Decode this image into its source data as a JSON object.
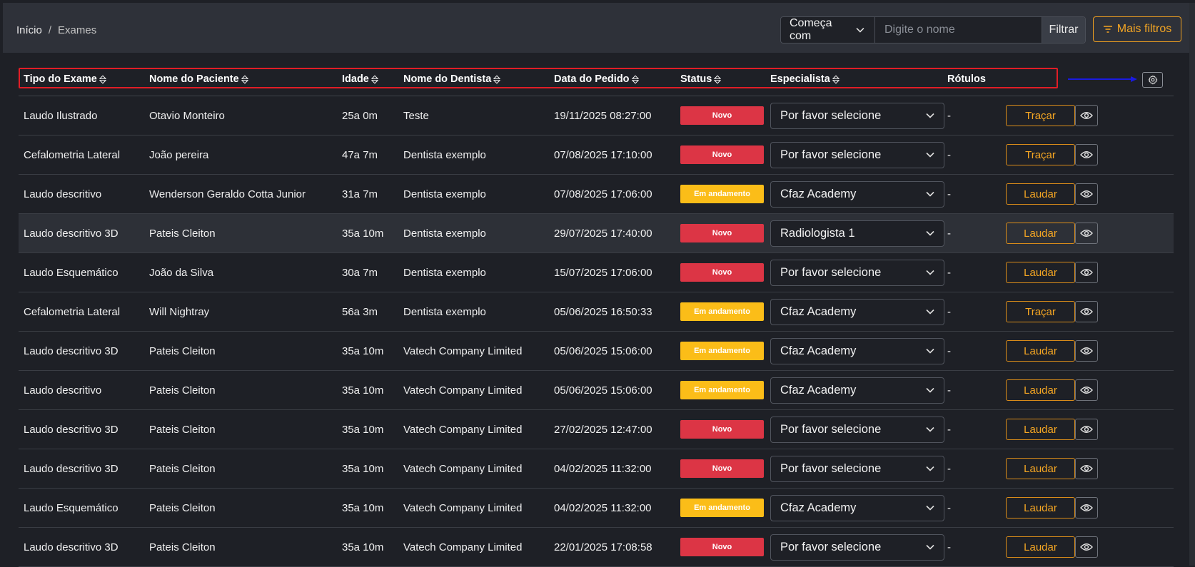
{
  "breadcrumb": {
    "home": "Início",
    "separator": "/",
    "current": "Exames"
  },
  "filter": {
    "mode": "Começa com",
    "placeholder": "Digite o nome",
    "value": "",
    "button": "Filtrar",
    "more_button": "Mais filtros"
  },
  "table": {
    "columns": [
      {
        "label": "Tipo do Exame",
        "sortable": true
      },
      {
        "label": "Nome do Paciente",
        "sortable": true
      },
      {
        "label": "Idade",
        "sortable": true
      },
      {
        "label": "Nome do Dentista",
        "sortable": true
      },
      {
        "label": "Data do Pedido",
        "sortable": true
      },
      {
        "label": "Status",
        "sortable": true
      },
      {
        "label": "Especialista",
        "sortable": true
      },
      {
        "label": "Rótulos",
        "sortable": false
      }
    ],
    "rows": [
      {
        "exam": "Laudo Ilustrado",
        "patient": "Otavio Monteiro",
        "age": "25a 0m",
        "dentist": "Teste",
        "date": "19/11/2025 08:27:00",
        "status": "Novo",
        "specialist": "Por favor selecione",
        "labels": "-",
        "action": "Traçar"
      },
      {
        "exam": "Cefalometria Lateral",
        "patient": "João pereira",
        "age": "47a 7m",
        "dentist": "Dentista exemplo",
        "date": "07/08/2025 17:10:00",
        "status": "Novo",
        "specialist": "Por favor selecione",
        "labels": "-",
        "action": "Traçar"
      },
      {
        "exam": "Laudo descritivo",
        "patient": "Wenderson Geraldo Cotta Junior",
        "age": "31a 7m",
        "dentist": "Dentista exemplo",
        "date": "07/08/2025 17:06:00",
        "status": "Em andamento",
        "specialist": "Cfaz Academy",
        "labels": "-",
        "action": "Laudar"
      },
      {
        "exam": "Laudo descritivo 3D",
        "patient": "Pateis Cleiton",
        "age": "35a 10m",
        "dentist": "Dentista exemplo",
        "date": "29/07/2025 17:40:00",
        "status": "Novo",
        "specialist": "Radiologista 1",
        "labels": "-",
        "action": "Laudar"
      },
      {
        "exam": "Laudo Esquemático",
        "patient": "João da Silva",
        "age": "30a 7m",
        "dentist": "Dentista exemplo",
        "date": "15/07/2025 17:06:00",
        "status": "Novo",
        "specialist": "Por favor selecione",
        "labels": "-",
        "action": "Laudar"
      },
      {
        "exam": "Cefalometria Lateral",
        "patient": "Will Nightray",
        "age": "56a 3m",
        "dentist": "Dentista exemplo",
        "date": "05/06/2025 16:50:33",
        "status": "Em andamento",
        "specialist": "Cfaz Academy",
        "labels": "-",
        "action": "Traçar"
      },
      {
        "exam": "Laudo descritivo 3D",
        "patient": "Pateis Cleiton",
        "age": "35a 10m",
        "dentist": "Vatech Company Limited",
        "date": "05/06/2025 15:06:00",
        "status": "Em andamento",
        "specialist": "Cfaz Academy",
        "labels": "-",
        "action": "Laudar"
      },
      {
        "exam": "Laudo descritivo",
        "patient": "Pateis Cleiton",
        "age": "35a 10m",
        "dentist": "Vatech Company Limited",
        "date": "05/06/2025 15:06:00",
        "status": "Em andamento",
        "specialist": "Cfaz Academy",
        "labels": "-",
        "action": "Laudar"
      },
      {
        "exam": "Laudo descritivo 3D",
        "patient": "Pateis Cleiton",
        "age": "35a 10m",
        "dentist": "Vatech Company Limited",
        "date": "27/02/2025 12:47:00",
        "status": "Novo",
        "specialist": "Por favor selecione",
        "labels": "-",
        "action": "Laudar"
      },
      {
        "exam": "Laudo descritivo 3D",
        "patient": "Pateis Cleiton",
        "age": "35a 10m",
        "dentist": "Vatech Company Limited",
        "date": "04/02/2025 11:32:00",
        "status": "Novo",
        "specialist": "Por favor selecione",
        "labels": "-",
        "action": "Laudar"
      },
      {
        "exam": "Laudo Esquemático",
        "patient": "Pateis Cleiton",
        "age": "35a 10m",
        "dentist": "Vatech Company Limited",
        "date": "04/02/2025 11:32:00",
        "status": "Em andamento",
        "specialist": "Cfaz Academy",
        "labels": "-",
        "action": "Laudar"
      },
      {
        "exam": "Laudo descritivo 3D",
        "patient": "Pateis Cleiton",
        "age": "35a 10m",
        "dentist": "Vatech Company Limited",
        "date": "22/01/2025 17:08:58",
        "status": "Novo",
        "specialist": "Por favor selecione",
        "labels": "-",
        "action": "Laudar"
      }
    ],
    "hovered_row": 3
  },
  "icons": {
    "sort": "sort-icon",
    "chevron": "chevron-down-icon",
    "filter": "filter-lines-icon",
    "gear": "gear-icon",
    "eye": "eye-icon",
    "annotation_arrow": "arrow-right-icon"
  },
  "colors": {
    "background": "#1e2026",
    "topbar": "#2e3139",
    "accent_orange": "#f5a623",
    "status_new": "#dc3545",
    "status_in_progress": "#fbbd18",
    "highlight_box": "#e11d26",
    "annotation_arrow": "#1a1adf"
  }
}
